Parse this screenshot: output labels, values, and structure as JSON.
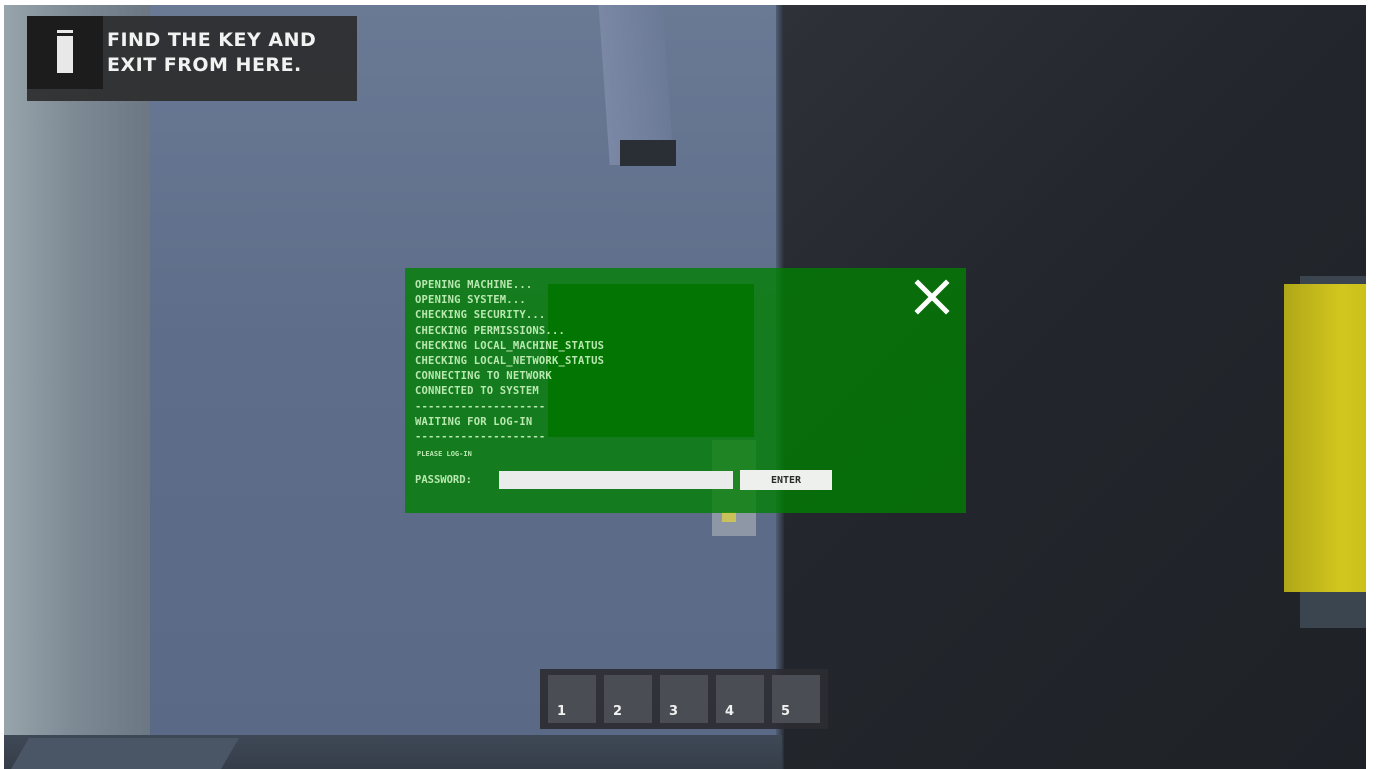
{
  "objective": {
    "icon": "info-icon",
    "text": "FIND THE KEY AND EXIT FROM HERE."
  },
  "terminal": {
    "log": [
      "OPENING MACHINE...",
      "OPENING SYSTEM...",
      "CHECKING SECURITY...",
      "CHECKING PERMISSIONS...",
      "CHECKING LOCAL_MACHINE_STATUS",
      "CHECKING LOCAL_NETWORK_STATUS",
      "CONNECTING TO NETWORK",
      "CONNECTED TO SYSTEM",
      "--------------------",
      "WAITING FOR LOG-IN",
      "--------------------"
    ],
    "hint": "PLEASE LOG-IN",
    "password_label": "PASSWORD:",
    "password_value": "",
    "enter_label": "ENTER",
    "close_icon": "close-icon",
    "background_color": "#008000"
  },
  "hotbar": {
    "slots": [
      "1",
      "2",
      "3",
      "4",
      "5"
    ]
  },
  "colors": {
    "terminal_text": "#b9e8b0",
    "yellow_panel": "#d2c61e"
  }
}
